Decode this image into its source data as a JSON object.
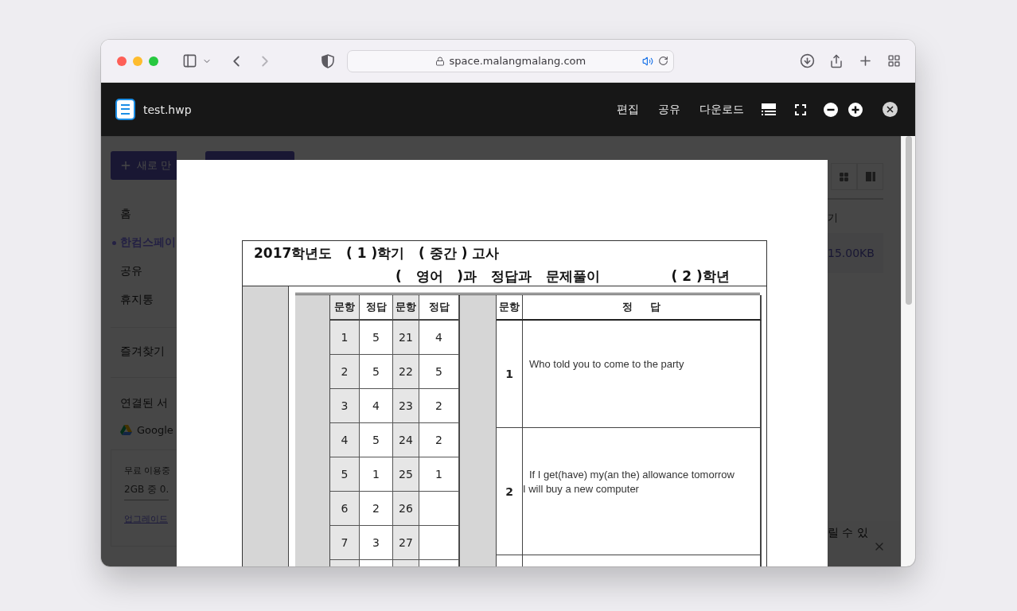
{
  "browser": {
    "url": "space.malangmalang.com"
  },
  "app": {
    "new_button": "새로 만",
    "sidebar": {
      "items": [
        {
          "label": "홈",
          "selected": false
        },
        {
          "label": "한컴스페이",
          "selected": true
        },
        {
          "label": "공유",
          "selected": false
        },
        {
          "label": "휴지통",
          "selected": false
        }
      ],
      "favorites": "즐겨찾기",
      "connected_title": "연결된 서",
      "services": [
        "Google"
      ],
      "storage": {
        "plan": "무료 이용중",
        "usage": "2GB 중 0.",
        "link": "업그레이드"
      }
    },
    "main": {
      "column_header": "기",
      "file_size": "15.00KB",
      "toast": "릴 수 있"
    }
  },
  "viewer": {
    "file_name": "test.hwp",
    "actions": [
      "편집",
      "공유",
      "다운로드"
    ]
  },
  "document": {
    "title_line1": "2017학년도   ( 1 )학기   ( 중간 ) 고사",
    "title_line2": "(   영어   )과   정답과   문제풀이",
    "grade": "( 2 )학년",
    "answer_grid": {
      "columns": [
        "문항",
        "정답",
        "문항",
        "정답"
      ],
      "rows": [
        [
          "1",
          "5",
          "21",
          "4"
        ],
        [
          "2",
          "5",
          "22",
          "5"
        ],
        [
          "3",
          "4",
          "23",
          "2"
        ],
        [
          "4",
          "5",
          "24",
          "2"
        ],
        [
          "5",
          "1",
          "25",
          "1"
        ],
        [
          "6",
          "2",
          "26"
        ],
        [
          "7",
          "3",
          "27"
        ]
      ]
    },
    "written": {
      "columns": [
        "문항",
        "정     답"
      ],
      "rows": [
        {
          "number": "1",
          "lines": [
            "Who told you to come to the party"
          ]
        },
        {
          "number": "2",
          "lines": [
            "If I get(have) my(an the) allowance tomorrow",
            "I will buy a new computer"
          ]
        }
      ]
    }
  }
}
